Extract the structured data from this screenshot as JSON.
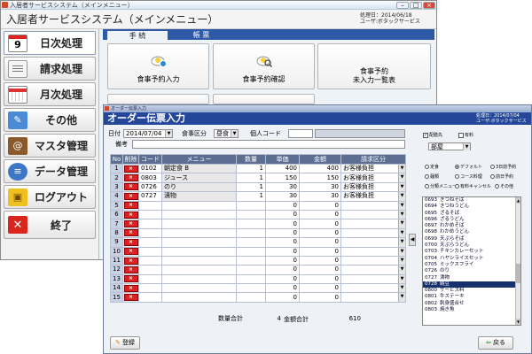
{
  "main": {
    "window_title": "入居者サービスシステム（メインメニュー）",
    "header_title": "入居者サービスシステム（メインメニュー）",
    "info_lines": [
      "処理日：2014/06/18",
      "ユーザ:ボタックサービス"
    ],
    "calendar_day": "9",
    "menu": [
      {
        "label": "日次処理",
        "icon": "calendar-icon"
      },
      {
        "label": "請求処理",
        "icon": "document-icon"
      },
      {
        "label": "月次処理",
        "icon": "month-calendar-icon"
      },
      {
        "label": "その他",
        "icon": "notebook-icon"
      },
      {
        "label": "マスタ管理",
        "icon": "address-book-icon"
      },
      {
        "label": "データ管理",
        "icon": "database-icon"
      },
      {
        "label": "ログアウト",
        "icon": "lock-icon"
      },
      {
        "label": "終了",
        "icon": "close-icon"
      }
    ],
    "tabs": [
      "手 続",
      "帳 票"
    ],
    "cards": [
      {
        "label": "食事予約入力",
        "icon": "meal-clock-icon"
      },
      {
        "label": "食事予約確認",
        "icon": "meal-search-icon"
      },
      {
        "label_lines": [
          "食事予約",
          "未入力一覧表"
        ],
        "icon": ""
      }
    ]
  },
  "order": {
    "window_title": "オーダー伝票入力",
    "header_title": "オーダー伝票入力",
    "info_lines": [
      "処理日：2014/07/04",
      "ユーザ:ボタックサービス"
    ],
    "date_label": "日付",
    "date_value": "2014/07/04",
    "meal_label": "食事区分",
    "meal_value": "昼食",
    "personal_code_label": "個人コード",
    "personal_code_value": "",
    "remarks_label": "備考",
    "columns": [
      "No",
      "削除",
      "コード",
      "メニュー",
      "数量",
      "単価",
      "金額",
      "請求区分"
    ],
    "delete_label": "×",
    "rows": [
      {
        "no": "1",
        "code": "0102",
        "menu": "朝定食 B",
        "qty": "1",
        "price": "400",
        "amount": "400",
        "billing": "お客様負担"
      },
      {
        "no": "2",
        "code": "0803",
        "menu": "ジュース",
        "qty": "1",
        "price": "150",
        "amount": "150",
        "billing": "お客様負担"
      },
      {
        "no": "3",
        "code": "0726",
        "menu": "のり",
        "qty": "1",
        "price": "30",
        "amount": "30",
        "billing": "お客様負担"
      },
      {
        "no": "4",
        "code": "0727",
        "menu": "漬物",
        "qty": "1",
        "price": "30",
        "amount": "30",
        "billing": "お客様負担"
      },
      {
        "no": "5",
        "code": "",
        "menu": "",
        "qty": "",
        "price": "0",
        "amount": "0",
        "billing": ""
      },
      {
        "no": "6",
        "code": "",
        "menu": "",
        "qty": "",
        "price": "0",
        "amount": "0",
        "billing": ""
      },
      {
        "no": "7",
        "code": "",
        "menu": "",
        "qty": "",
        "price": "0",
        "amount": "0",
        "billing": ""
      },
      {
        "no": "8",
        "code": "",
        "menu": "",
        "qty": "",
        "price": "0",
        "amount": "0",
        "billing": ""
      },
      {
        "no": "9",
        "code": "",
        "menu": "",
        "qty": "",
        "price": "0",
        "amount": "0",
        "billing": ""
      },
      {
        "no": "10",
        "code": "",
        "menu": "",
        "qty": "",
        "price": "0",
        "amount": "0",
        "billing": ""
      },
      {
        "no": "11",
        "code": "",
        "menu": "",
        "qty": "",
        "price": "0",
        "amount": "0",
        "billing": ""
      },
      {
        "no": "12",
        "code": "",
        "menu": "",
        "qty": "",
        "price": "0",
        "amount": "0",
        "billing": ""
      },
      {
        "no": "13",
        "code": "",
        "menu": "",
        "qty": "",
        "price": "0",
        "amount": "0",
        "billing": ""
      },
      {
        "no": "14",
        "code": "",
        "menu": "",
        "qty": "",
        "price": "0",
        "amount": "0",
        "billing": ""
      },
      {
        "no": "15",
        "code": "",
        "menu": "",
        "qty": "",
        "price": "0",
        "amount": "0",
        "billing": ""
      }
    ],
    "qty_total_label": "数量合計",
    "qty_total": "4",
    "amount_total_label": "金額合計",
    "amount_total": "610",
    "delivery_label": "配膳先",
    "pay_label": "有料",
    "location_value": "部屋",
    "options_row1": [
      "定食",
      "デフォルト",
      "3日前予約"
    ],
    "options_row2": [
      "麺類",
      "コース料理",
      "前日予約"
    ],
    "options_row3": [
      "分類メニュー",
      "有料キャンセル",
      "その他"
    ],
    "food_list": [
      {
        "code": "0693",
        "name": "きつねそば"
      },
      {
        "code": "0694",
        "name": "きつねうどん"
      },
      {
        "code": "0695",
        "name": "ざるそば"
      },
      {
        "code": "0696",
        "name": "ざるうどん"
      },
      {
        "code": "0697",
        "name": "わかめそば"
      },
      {
        "code": "0698",
        "name": "わかめうどん"
      },
      {
        "code": "0699",
        "name": "天ぷらそば"
      },
      {
        "code": "0700",
        "name": "天ぷらうどん"
      },
      {
        "code": "0703",
        "name": "チキンカレーセット"
      },
      {
        "code": "0704",
        "name": "ハヤシライスセット"
      },
      {
        "code": "0705",
        "name": "ミックスフライ"
      },
      {
        "code": "0726",
        "name": "のり"
      },
      {
        "code": "0727",
        "name": "漬物"
      },
      {
        "code": "0728",
        "name": "納豆"
      },
      {
        "code": "0800",
        "name": "サービス料"
      },
      {
        "code": "0801",
        "name": "牛ステーキ"
      },
      {
        "code": "0802",
        "name": "刺身盛合せ"
      },
      {
        "code": "0803",
        "name": "焼き魚"
      }
    ],
    "selected_food_index": 13,
    "register_label": "登録",
    "back_label": "戻る"
  }
}
